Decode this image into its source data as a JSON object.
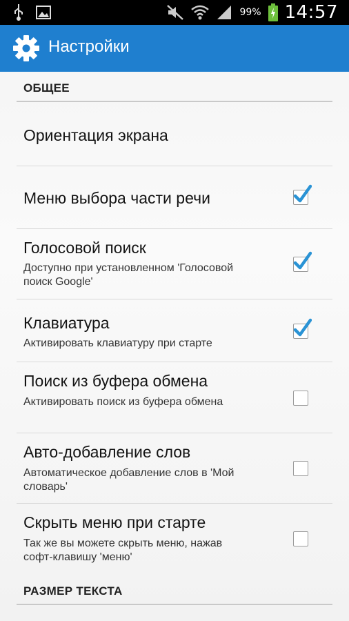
{
  "status_bar": {
    "icons_left": [
      "usb-icon",
      "image-icon"
    ],
    "icons_right": [
      "mute-icon",
      "wifi-icon",
      "signal-icon",
      "battery-icon"
    ],
    "battery": "99%",
    "time": "14:57"
  },
  "action_bar": {
    "title": "Настройки",
    "icon": "gear-icon",
    "color": "#1f7fcf"
  },
  "sections": [
    {
      "header": "ОБЩЕЕ"
    },
    {
      "header": "РАЗМЕР ТЕКСТА"
    }
  ],
  "settings": [
    {
      "title": "Ориентация экрана"
    },
    {
      "title": "Меню выбора части речи",
      "checked": true
    },
    {
      "title": "Голосовой поиск",
      "summary": "Доступно при установленном 'Голосовой поиск Google'",
      "checked": true
    },
    {
      "title": "Клавиатура",
      "summary": "Активировать клавиатуру при старте",
      "checked": true
    },
    {
      "title": "Поиск из буфера обмена",
      "summary": "Активировать поиск из буфера обмена",
      "checked": false
    },
    {
      "title": "Авто-добавление слов",
      "summary": "Автоматическое добавление слов в 'Мой словарь'",
      "checked": false
    },
    {
      "title": "Скрыть меню при старте",
      "summary": "Так же вы можете скрыть меню, нажав софт-клавишу 'меню'",
      "checked": false
    }
  ]
}
